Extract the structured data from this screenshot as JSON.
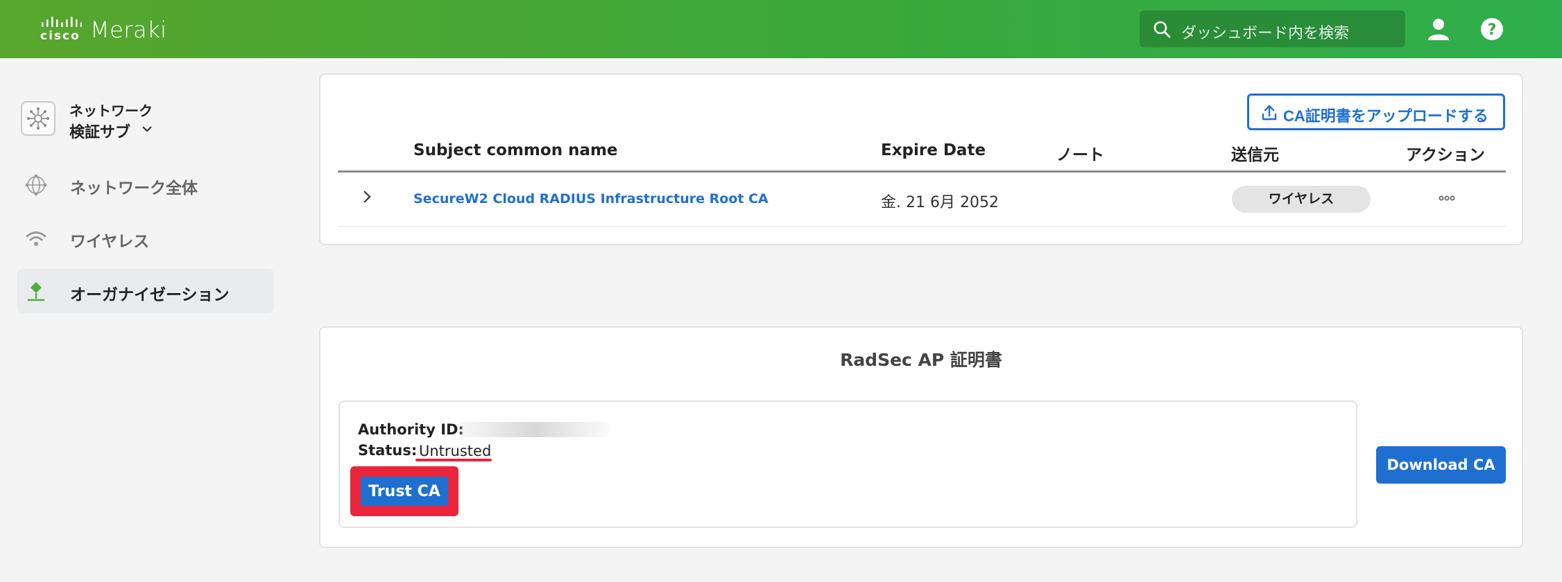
{
  "header": {
    "logo_cisco": "cisco",
    "logo_meraki": "Meraki",
    "search_placeholder": "ダッシュボード内を検索",
    "user_icon": "user-icon",
    "help_icon": "help-icon"
  },
  "sidebar": {
    "network_label": "ネットワーク",
    "network_name": "検証サブ",
    "items": [
      {
        "label": "ネットワーク全体",
        "icon": "globe-network-icon",
        "active": false
      },
      {
        "label": "ワイヤレス",
        "icon": "wifi-icon",
        "active": false
      },
      {
        "label": "オーガナイゼーション",
        "icon": "organization-icon",
        "active": true
      }
    ]
  },
  "ca_table": {
    "upload_button": "CA証明書をアップロードする",
    "columns": [
      "Subject common name",
      "Expire Date",
      "ノート",
      "送信元",
      "アクション"
    ],
    "rows": [
      {
        "subject": "SecureW2 Cloud RADIUS Infrastructure Root CA",
        "expire": "金. 21 6月 2052",
        "note": "",
        "source": "ワイヤレス"
      }
    ]
  },
  "radsec": {
    "title": "RadSec AP 証明書",
    "authority_label": "Authority ID:",
    "status_label": "Status:",
    "status_value": "Untrusted",
    "trust_button": "Trust CA",
    "download_button": "Download CA"
  },
  "colors": {
    "accent": "#1f6fd1",
    "header_green": "#3aa83a",
    "highlight_red": "#e8253a"
  }
}
